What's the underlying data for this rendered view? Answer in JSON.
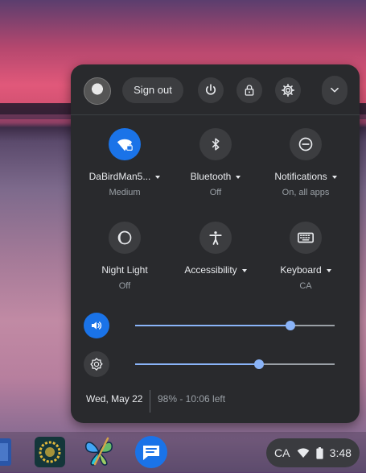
{
  "quick_settings": {
    "sign_out_label": "Sign out",
    "tiles": [
      {
        "label": "DaBirdMan5...",
        "sub": "Medium",
        "icon": "wifi-lock-icon",
        "active": true
      },
      {
        "label": "Bluetooth",
        "sub": "Off",
        "icon": "bluetooth-icon",
        "active": false
      },
      {
        "label": "Notifications",
        "sub": "On, all apps",
        "icon": "do-not-disturb-icon",
        "active": false
      },
      {
        "label": "Night Light",
        "sub": "Off",
        "icon": "night-light-icon",
        "active": false
      },
      {
        "label": "Accessibility",
        "sub": "",
        "icon": "accessibility-icon",
        "active": false
      },
      {
        "label": "Keyboard",
        "sub": "CA",
        "icon": "keyboard-icon",
        "active": false
      }
    ],
    "volume_level": 0.78,
    "brightness_level": 0.62,
    "date": "Wed, May 22",
    "battery": "98% - 10:06 left"
  },
  "shelf": {
    "status_ime": "CA",
    "status_time": "3:48"
  },
  "colors": {
    "accent": "#1a73e8",
    "slider": "#8ab4f8",
    "panel": "#292a2d"
  }
}
